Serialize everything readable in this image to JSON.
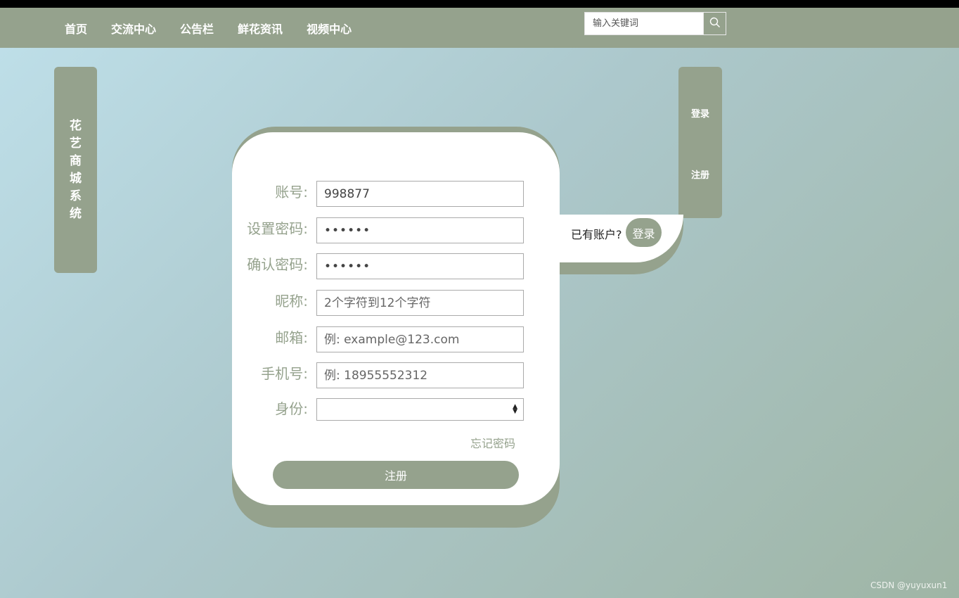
{
  "nav": {
    "items": [
      {
        "label": "首页"
      },
      {
        "label": "交流中心"
      },
      {
        "label": "公告栏"
      },
      {
        "label": "鲜花资讯"
      },
      {
        "label": "视频中心"
      }
    ],
    "search_placeholder": "输入关键词",
    "search_icon": "search-icon"
  },
  "sidebar_left": {
    "title": "花艺商城系统"
  },
  "sidebar_right": {
    "login_label": "登录",
    "register_label": "注册"
  },
  "login_prompt": {
    "text": "已有账户?",
    "button": "登录"
  },
  "form": {
    "fields": [
      {
        "label": "账号:",
        "value": "998877",
        "placeholder": ""
      },
      {
        "label": "设置密码:",
        "value": "••••••",
        "placeholder": ""
      },
      {
        "label": "确认密码:",
        "value": "••••••",
        "placeholder": ""
      },
      {
        "label": "昵称:",
        "value": "",
        "placeholder": "2个字符到12个字符"
      },
      {
        "label": "邮箱:",
        "value": "",
        "placeholder": "例: example@123.com"
      },
      {
        "label": "手机号:",
        "value": "",
        "placeholder": "例: 18955552312"
      }
    ],
    "role": {
      "label": "身份:",
      "selected": ""
    },
    "forgot_label": "忘记密码",
    "submit_label": "注册"
  },
  "watermark": "CSDN @yuyuxun1",
  "colors": {
    "accent": "#95a28d",
    "card": "#ffffff"
  }
}
